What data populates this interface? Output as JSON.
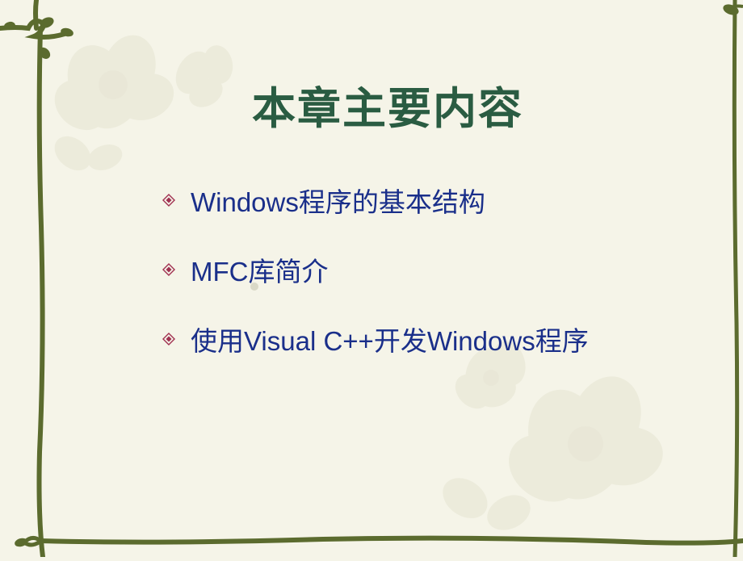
{
  "slide": {
    "title": "本章主要内容",
    "bullets": [
      "Windows程序的基本结构",
      "MFC库简介",
      "使用Visual C++开发Windows程序"
    ]
  },
  "colors": {
    "title": "#2a5c42",
    "bullet_text": "#1a2f8a",
    "bullet_marker": "#a03050",
    "vine": "#5b6b2e",
    "flower": "#d4d2b8",
    "background": "#f5f4e8"
  }
}
